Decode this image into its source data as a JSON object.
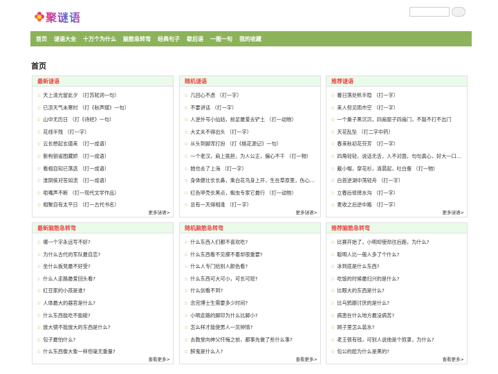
{
  "site": {
    "logo_text": "聚谜语",
    "search_button": ""
  },
  "nav": [
    "首页",
    "谜语大全",
    "十万个为什么",
    "脑筋急转弯",
    "经典句子",
    "歇后语",
    "一图一句",
    "我的收藏"
  ],
  "page_title": "首页",
  "boxes": [
    {
      "title": "最新谜语",
      "more": "更多谜语>",
      "items": [
        "天上清光留此夕 （打苏轼词一句）",
        "已凉天气未寒时 （打《秋声赋》一句）",
        "山中无历日 （打《诗经》一句）",
        "花线半残 （打一字）",
        "云长想起玄德来 （打一成语）",
        "新构钥省图藏娇 （打一成语）",
        "看相自知已落选 （打一成语）",
        "淮阴侯对答如流 （打一成语）",
        "唢嘴声不断 （打一现代文学作品）",
        "相聚自有太平日 （打一古代书名）"
      ]
    },
    {
      "title": "随机谜语",
      "more": "更多谜语>",
      "items": [
        "几回心不虑 （打一字）",
        "不要讲话 （打一字）",
        "人逆外号小仙姑，前足最爱去铲土 （打一动物）",
        "大丈夫不得出头 （打一字）",
        "从头到脚浑打扮 （打《桃花源记》一句）",
        "一个老汉，肩上挑担，为人公正，偏心不干 （打一物）",
        "她也去了上海 （打一字）",
        "身体健壮长长鼻，乘白花鸟身上开，生在草原里，伤心流泪又无声 （打一动物）",
        "红色甲壳长黑点，蜘虫专家它最行 （打一动物）",
        "总有一天得相逢 （打一字）"
      ]
    },
    {
      "title": "推荐谜语",
      "more": "更多谜语>",
      "items": [
        "暮日落处帆半隐 （打一字）",
        "来人但见雨市空 （打一字）",
        "一个巢子黑沉沉，四扇窗子四扇门，不敲不打不出门",
        "天花乱坠 （打二字中药）",
        "春来秋初花芬芳 （打一字）",
        "四角轻轻，说话无舌，人不对面，句句真心，好大一口气 （打一物）",
        "戴小帽，穿花衫，清晨起，吐白蚕 （打一物）",
        "白首逆湖中荡轻舟 （打一字）",
        "立春后修择水沟 （打一字）",
        "麦收之后逆中路 （打一字）"
      ]
    },
    {
      "title": "最新脑筋急转弯",
      "more": "查看更多>",
      "items": [
        "哪一个字永远写不好?",
        "为什么古代的军队最自恋?",
        "坐什么板凳最不好受?",
        "什么人走路最爱回头看?",
        "红豆家的小孩是谁?",
        "人体最大的器官是什么?",
        "什么东西能吃不能碰?",
        "放大镜不能放大的东西是什么?",
        "包子最怕什么?",
        "什么东西像大象一样但毫无重量?"
      ]
    },
    {
      "title": "随机脑筋急转弯",
      "more": "查看更多>",
      "items": [
        "什么东西人们都不喜欢吃?",
        "什么东西看不见摸不着却很重要?",
        "什么人专门给别人颜色看?",
        "什么东西可大可小，可长可短?",
        "什么剑看不到?",
        "念完博士生需要多少时间?",
        "小明走路的脚印为什么比脚小?",
        "怎么样才能使男人一见钟情?",
        "去教堂向神父忏悔之前，都事先做了些什么事?",
        "醉鬼是什么人?"
      ]
    },
    {
      "title": "推荐脑筋急转弯",
      "more": "查看更多>",
      "items": [
        "比赛开始了，小明却使劲往后跑，为什么?",
        "聪明人比一般人多了个什么?",
        "冰到底是什么东西?",
        "吃饭的时候最扫兴的是什么?",
        "比眼大的东西是什么?",
        "比乌鸦跟讨厌的是什么?",
        "病患在什么地方最没病苦?",
        "网子里怎么装水?",
        "老王很有钱，可别人说他是个奴隶，为什么?",
        "包公的脸为什么是黑的?"
      ]
    }
  ]
}
